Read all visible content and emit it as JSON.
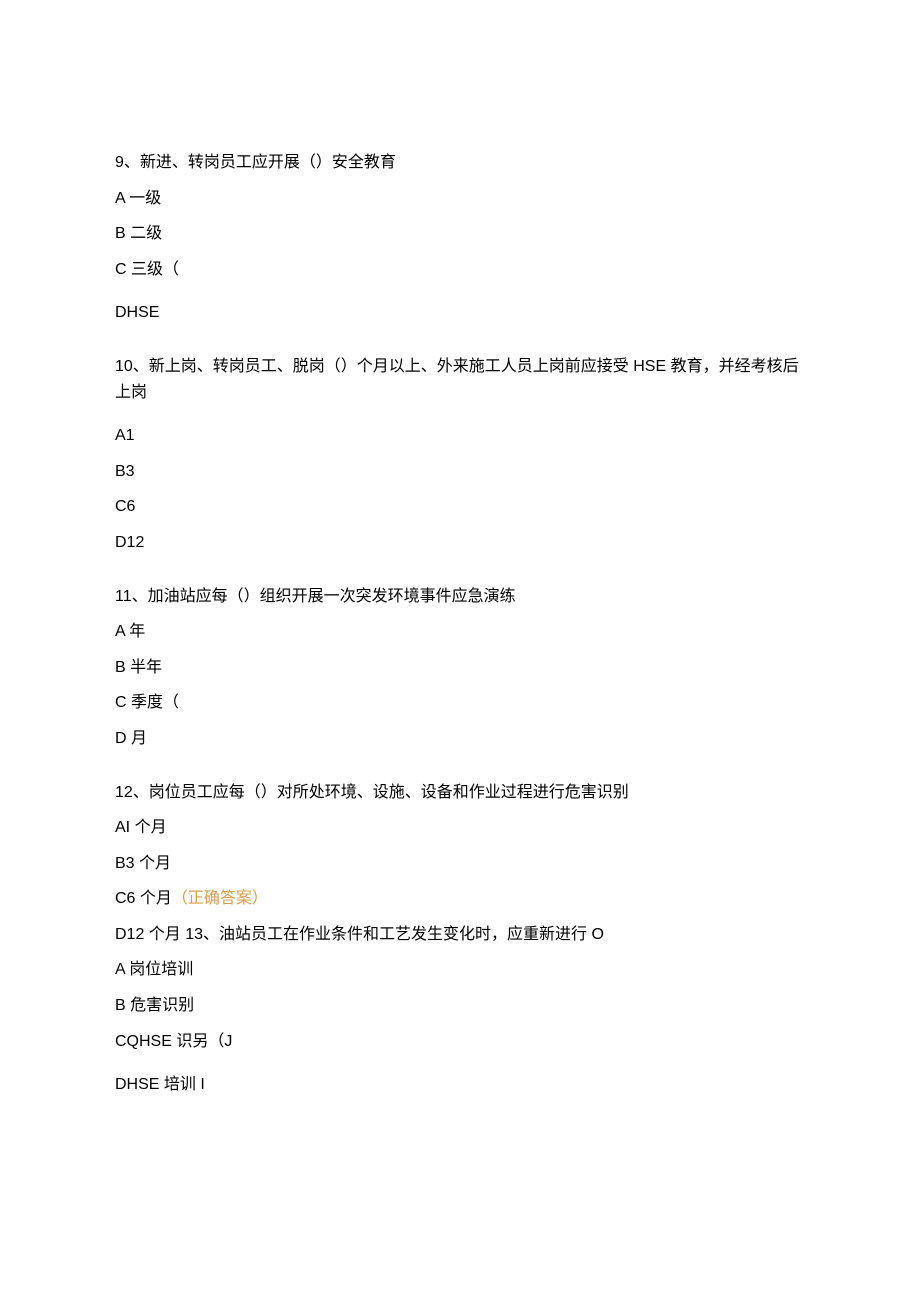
{
  "questions": [
    {
      "text": "9、新进、转岗员工应开展（）安全教育",
      "options": [
        "A 一级",
        "B 二级",
        "C 三级（",
        "DHSE"
      ]
    },
    {
      "text": "10、新上岗、转岗员工、脱岗（）个月以上、外来施工人员上岗前应接受 HSE 教育，并经考核后上岗",
      "options": [
        "A1",
        "B3",
        "C6",
        "D12"
      ]
    },
    {
      "text": "11、加油站应每（）组织开展一次突发环境事件应急演练",
      "options": [
        "A 年",
        "B 半年",
        "C 季度（",
        "D 月"
      ]
    },
    {
      "text": "12、岗位员工应每（）对所处环境、设施、设备和作业过程进行危害识别",
      "options": [
        "AI 个月",
        "B3 个月"
      ],
      "optionC": "C6 个月",
      "optionCAnswer": "（正确答案）",
      "optionsAfter": [
        "D12 个月 13、油站员工在作业条件和工艺发生变化时，应重新进行 O",
        "A 岗位培训",
        "B 危害识别",
        "CQHSE 识另（J",
        "DHSE 培训 I"
      ]
    }
  ]
}
